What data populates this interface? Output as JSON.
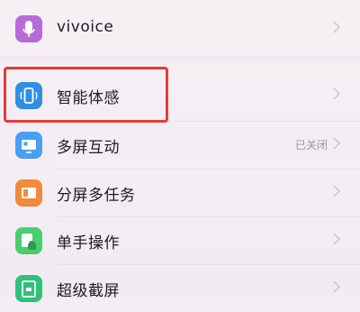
{
  "settings_list": {
    "items": [
      {
        "label": "vivoice",
        "icon": "microphone-icon",
        "color": "#b76ad8"
      },
      {
        "label": "智能体感",
        "icon": "phone-motion-icon",
        "color": "#2f8fe6"
      },
      {
        "label": "多屏互动",
        "icon": "screen-cast-icon",
        "color": "#47a0f2",
        "status": "已关闭"
      },
      {
        "label": "分屏多任务",
        "icon": "split-screen-icon",
        "color": "#f28a3b"
      },
      {
        "label": "单手操作",
        "icon": "one-hand-icon",
        "color": "#49cf6e"
      },
      {
        "label": "超级截屏",
        "icon": "screenshot-icon",
        "color": "#2fc27a"
      }
    ]
  },
  "highlight_color": "#e53a3a"
}
